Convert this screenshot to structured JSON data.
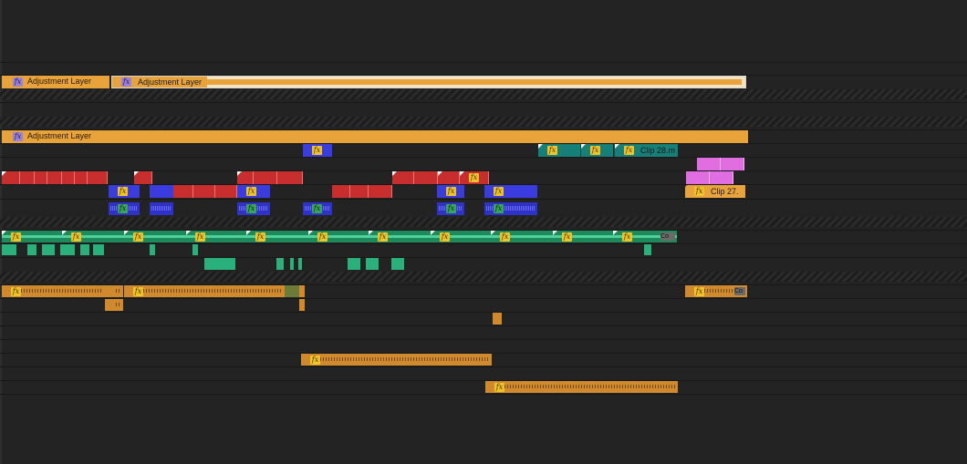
{
  "timeline": {
    "adjustment_layer_1": "Adjustment Layer",
    "adjustment_layer_2": "Adjustment Layer",
    "adjustment_layer_3": "Adjustment Layer",
    "clip_28": "Clip 28.m",
    "clip_27": "Clip 27.",
    "clip_cut_1": "Co",
    "clip_cut_2": "Co",
    "fx_badge": "fx"
  },
  "colors": {
    "adjustment": "#e8a43b",
    "video_red": "#c92e2e",
    "video_blue": "#3b3ce0",
    "video_teal": "#167f78",
    "video_pink": "#e06ee0",
    "video_green": "#1e8a5b",
    "audio_orange": "#d08a2d",
    "fx_purple": "#9c83d9",
    "fx_yellow": "#f0c426",
    "fx_green": "#3aa65b"
  }
}
